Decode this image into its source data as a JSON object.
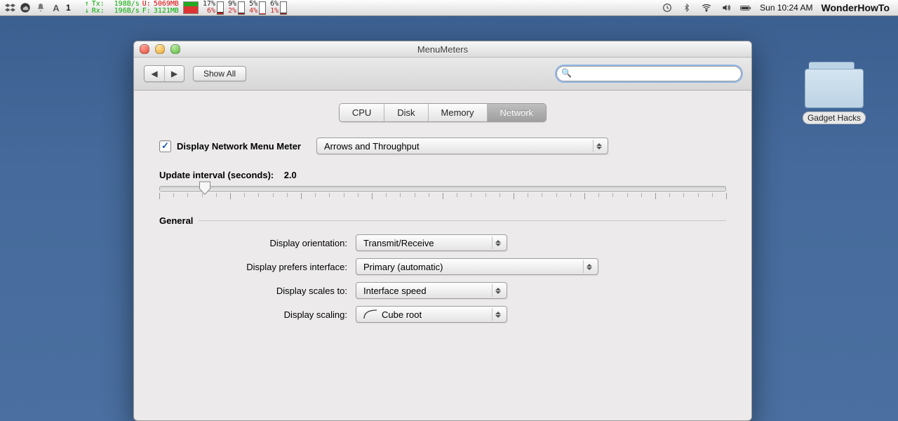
{
  "menubar": {
    "adobe_count": "1",
    "net": {
      "tx_label": "Tx:",
      "rx_label": "Rx:",
      "tx_rate": "198B/s",
      "rx_rate": "196B/s",
      "u_label": "U:",
      "u_val": "5069MB",
      "f_label": "F:",
      "f_val": "3121MB"
    },
    "cpu": [
      {
        "top": "17%",
        "bot": "6%"
      },
      {
        "top": "9%",
        "bot": "2%"
      },
      {
        "top": "5%",
        "bot": "4%"
      },
      {
        "top": "6%",
        "bot": "1%"
      }
    ],
    "clock": "Sun 10:24 AM",
    "app": "WonderHowTo"
  },
  "desktop": {
    "folder_label": "Gadget Hacks"
  },
  "window": {
    "title": "MenuMeters",
    "toolbar": {
      "show_all": "Show All",
      "search_placeholder": ""
    },
    "tabs": {
      "cpu": "CPU",
      "disk": "Disk",
      "memory": "Memory",
      "network": "Network"
    },
    "network": {
      "display_checkbox": "Display Network Menu Meter",
      "mode_select": "Arrows and Throughput",
      "interval_label": "Update interval (seconds):",
      "interval_value": "2.0",
      "general_header": "General",
      "rows": {
        "orientation": {
          "label": "Display orientation:",
          "value": "Transmit/Receive"
        },
        "prefers": {
          "label": "Display prefers interface:",
          "value": "Primary (automatic)"
        },
        "scales": {
          "label": "Display scales to:",
          "value": "Interface speed"
        },
        "scaling": {
          "label": "Display scaling:",
          "value": "Cube root"
        }
      }
    }
  }
}
